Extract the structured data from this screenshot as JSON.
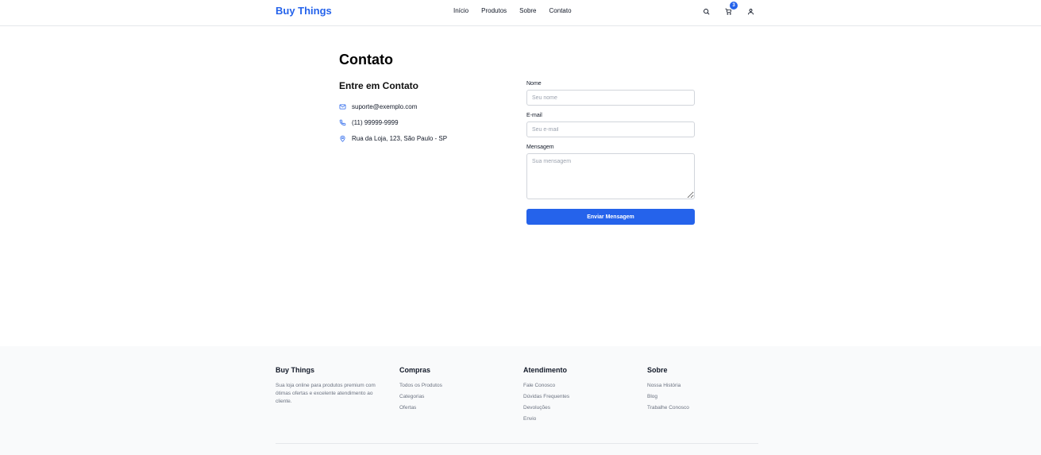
{
  "header": {
    "brand": "Buy Things",
    "nav": [
      "Início",
      "Produtos",
      "Sobre",
      "Contato"
    ],
    "icons": [
      "search-icon",
      "cart-icon",
      "user-icon"
    ],
    "cart_count": "3"
  },
  "main": {
    "title": "Contato",
    "contact_title": "Entre em Contato",
    "email": "suporte@exemplo.com",
    "phone": "(11) 99999-9999",
    "address": "Rua da Loja, 123, São Paulo - SP"
  },
  "form": {
    "name_label": "Nome",
    "name_placeholder": "Seu nome",
    "email_label": "E-mail",
    "email_placeholder": "Seu e-mail",
    "message_label": "Mensagem",
    "message_placeholder": "Sua mensagem",
    "submit_label": "Enviar Mensagem"
  },
  "footer": {
    "brand": "Buy Things",
    "description": "Sua loja online para produtos premium com ótimas ofertas e excelente atendimento ao cliente.",
    "shop_title": "Compras",
    "shop_links": [
      "Todos os Produtos",
      "Categorias",
      "Ofertas"
    ],
    "support_title": "Atendimento",
    "support_links": [
      "Fale Conosco",
      "Dúvidas Frequentes",
      "Devoluções",
      "Envio"
    ],
    "about_title": "Sobre",
    "about_links": [
      "Nossa História",
      "Blog",
      "Trabalhe Conosco"
    ]
  },
  "colors": {
    "accent": "#2563eb",
    "footer_bg": "#f9fafb",
    "muted_text": "#6b7280"
  }
}
